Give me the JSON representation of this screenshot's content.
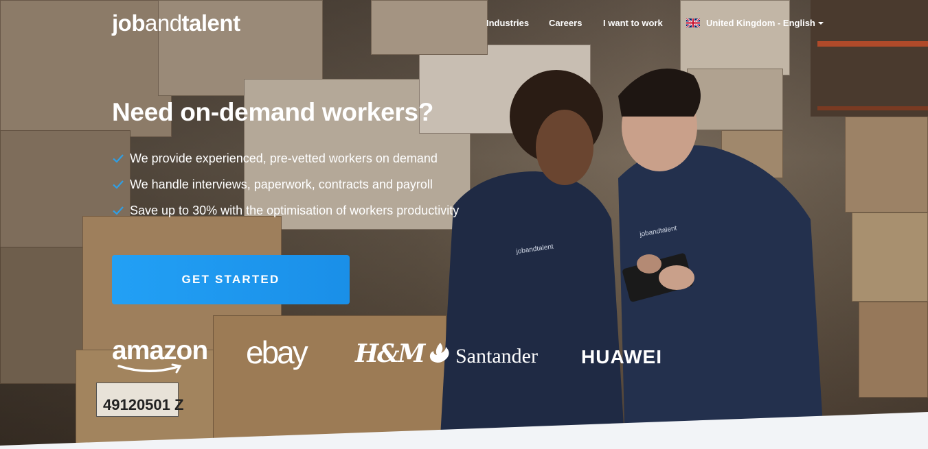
{
  "header": {
    "logo": {
      "part1": "job",
      "part2": "and",
      "part3": "talent"
    },
    "nav": [
      {
        "label": "Industries"
      },
      {
        "label": "Careers"
      },
      {
        "label": "I want to work"
      }
    ],
    "locale": {
      "label": "United Kingdom - English",
      "flag_icon": "uk-flag-icon"
    }
  },
  "hero": {
    "headline": "Need on-demand workers?",
    "bullets": [
      "We provide experienced, pre-vetted workers on demand",
      "We handle interviews, paperwork, contracts and payroll",
      "Save up to 30% with the optimisation of workers productivity"
    ],
    "check_icon": "check-icon",
    "cta_label": "GET STARTED",
    "jacket_logo": "jobandtalent"
  },
  "partners": {
    "amazon": "amazon",
    "ebay": "ebay",
    "hm": "H&M",
    "santander": "Santander",
    "huawei": "HUAWEI"
  },
  "box_label": "49120501 Z",
  "colors": {
    "accent": "#1a8fe8",
    "check": "#2e9fe6",
    "text": "#ffffff",
    "footer_bg": "#f2f4f7"
  }
}
